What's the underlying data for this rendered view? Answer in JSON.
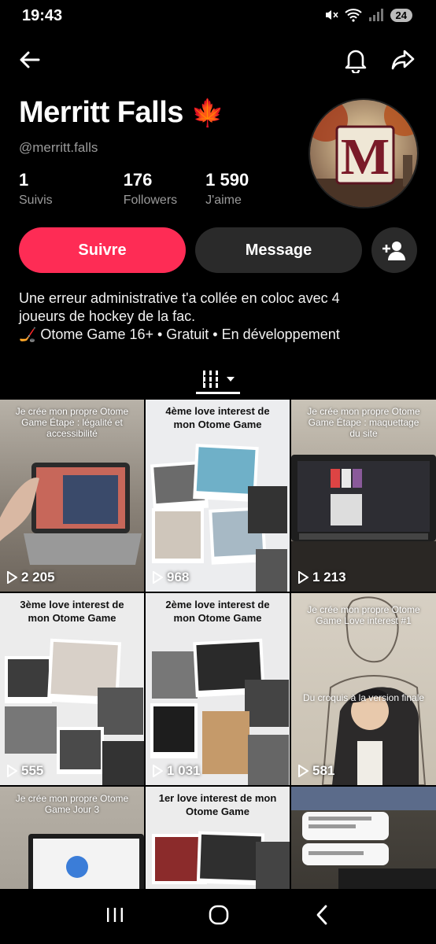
{
  "status": {
    "time": "19:43",
    "battery": "24"
  },
  "profile": {
    "name": "Merritt Falls",
    "emoji": "🍁",
    "handle": "@merritt.falls",
    "avatar_letter": "M"
  },
  "stats": [
    {
      "number": "1",
      "label": "Suivis"
    },
    {
      "number": "176",
      "label": "Followers"
    },
    {
      "number": "1 590",
      "label": "J'aime"
    }
  ],
  "actions": {
    "follow": "Suivre",
    "message": "Message"
  },
  "bio": [
    "Une erreur administrative t'a collée en coloc avec 4",
    "joueurs de hockey de la fac.",
    "🏒 Otome Game 16+ • Gratuit • En développement"
  ],
  "videos": [
    {
      "caption": "Je crée mon propre Otome Game Étape : légalité et accessibilité",
      "views": "2 205"
    },
    {
      "caption": "4ème love interest de mon Otome Game",
      "views": "968"
    },
    {
      "caption": "Je crée mon propre Otome Game Étape : maquettage du site",
      "views": "1 213"
    },
    {
      "caption": "3ème love interest de mon Otome Game",
      "views": "555"
    },
    {
      "caption": "2ème love interest de mon Otome Game",
      "views": "1 031"
    },
    {
      "caption": "Je crée mon propre Otome Game Love interest #1",
      "caption2": "Du croquis à la version finale",
      "views": "581"
    },
    {
      "caption": "Je crée mon propre Otome Game Jour 3",
      "views": ""
    },
    {
      "caption": "1er love interest de mon Otome Game",
      "views": ""
    },
    {
      "caption": "",
      "views": ""
    }
  ],
  "colors": {
    "accent": "#fe2c55",
    "button_dark": "#2a2a2a",
    "muted": "#9a9a9a"
  }
}
